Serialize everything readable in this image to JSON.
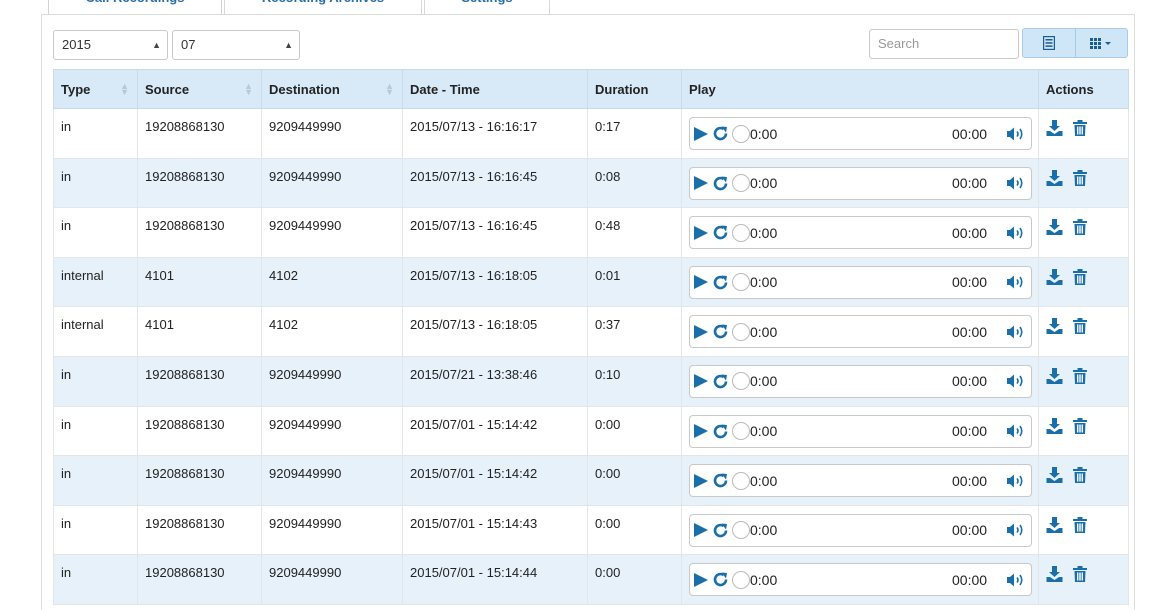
{
  "tabs": [
    {
      "label": "Call Recordings"
    },
    {
      "label": "Recording Archives"
    },
    {
      "label": "Settings"
    }
  ],
  "filters": {
    "year": "2015",
    "month": "07",
    "search_placeholder": "Search"
  },
  "columns": [
    "Type",
    "Source",
    "Destination",
    "Date - Time",
    "Duration",
    "Play",
    "Actions"
  ],
  "rows": [
    {
      "type": "in",
      "source": "19208868130",
      "destination": "9209449990",
      "datetime": "2015/07/13 - 16:16:17",
      "duration": "0:17",
      "current": "0:00",
      "total": "00:00"
    },
    {
      "type": "in",
      "source": "19208868130",
      "destination": "9209449990",
      "datetime": "2015/07/13 - 16:16:45",
      "duration": "0:08",
      "current": "0:00",
      "total": "00:00"
    },
    {
      "type": "in",
      "source": "19208868130",
      "destination": "9209449990",
      "datetime": "2015/07/13 - 16:16:45",
      "duration": "0:48",
      "current": "0:00",
      "total": "00:00"
    },
    {
      "type": "internal",
      "source": "4101",
      "destination": "4102",
      "datetime": "2015/07/13 - 16:18:05",
      "duration": "0:01",
      "current": "0:00",
      "total": "00:00"
    },
    {
      "type": "internal",
      "source": "4101",
      "destination": "4102",
      "datetime": "2015/07/13 - 16:18:05",
      "duration": "0:37",
      "current": "0:00",
      "total": "00:00"
    },
    {
      "type": "in",
      "source": "19208868130",
      "destination": "9209449990",
      "datetime": "2015/07/21 - 13:38:46",
      "duration": "0:10",
      "current": "0:00",
      "total": "00:00"
    },
    {
      "type": "in",
      "source": "19208868130",
      "destination": "9209449990",
      "datetime": "2015/07/01 - 15:14:42",
      "duration": "0:00",
      "current": "0:00",
      "total": "00:00"
    },
    {
      "type": "in",
      "source": "19208868130",
      "destination": "9209449990",
      "datetime": "2015/07/01 - 15:14:42",
      "duration": "0:00",
      "current": "0:00",
      "total": "00:00"
    },
    {
      "type": "in",
      "source": "19208868130",
      "destination": "9209449990",
      "datetime": "2015/07/01 - 15:14:43",
      "duration": "0:00",
      "current": "0:00",
      "total": "00:00"
    },
    {
      "type": "in",
      "source": "19208868130",
      "destination": "9209449990",
      "datetime": "2015/07/01 - 15:14:44",
      "duration": "0:00",
      "current": "0:00",
      "total": "00:00"
    }
  ],
  "icons": {
    "play": "play-icon",
    "loop": "refresh-icon",
    "volume": "volume-icon",
    "download": "download-icon",
    "delete": "trash-icon",
    "list_view": "list-view-icon",
    "grid_view": "grid-view-icon"
  },
  "colors": {
    "accent": "#1b6fa8",
    "header_bg": "#d8eaf8",
    "stripe_bg": "#e6f1fa"
  }
}
